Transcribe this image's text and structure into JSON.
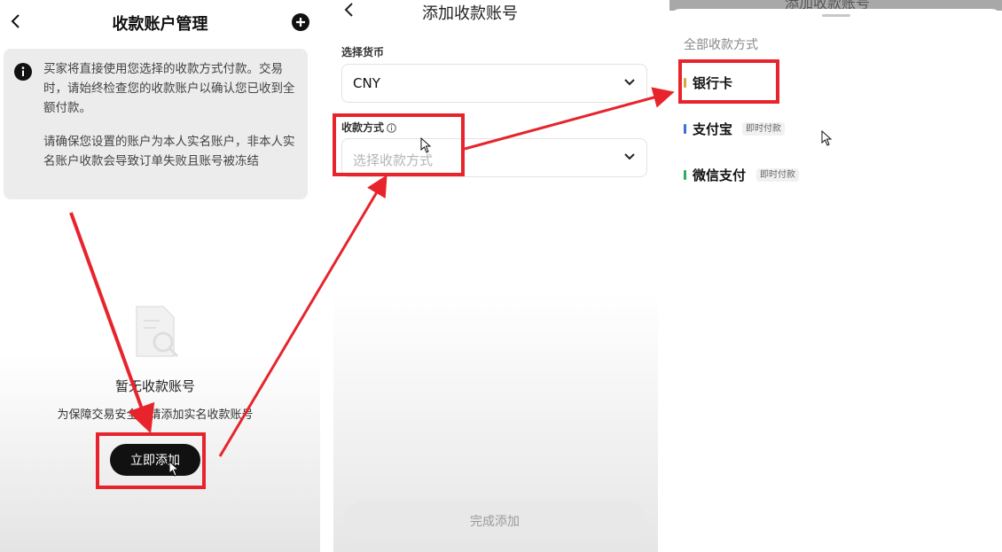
{
  "panel1": {
    "title": "收款账户管理",
    "notice_line1": "买家将直接使用您选择的收款方式付款。交易时，请始终检查您的收款账户以确认您已收到全额付款。",
    "notice_line2": "请确保您设置的账户为本人实名账户，非本人实名账户收款会导致订单失败且账号被冻结",
    "empty_title": "暂无收款账号",
    "empty_desc": "为保障交易安全，请添加实名收款账号",
    "add_button": "立即添加"
  },
  "panel2": {
    "title": "添加收款账号",
    "currency_label": "选择货币",
    "currency_value": "CNY",
    "method_label": "收款方式",
    "method_placeholder": "选择收款方式",
    "done_button": "完成添加"
  },
  "panel3": {
    "behind_title": "添加收款账号",
    "sheet_title": "全部收款方式",
    "options": [
      {
        "label": "银行卡",
        "badge": "",
        "color": "#d9a441"
      },
      {
        "label": "支付宝",
        "badge": "即时付款",
        "color": "#3b6fd6"
      },
      {
        "label": "微信支付",
        "badge": "即时付款",
        "color": "#2aae67"
      }
    ]
  },
  "colors": {
    "annotation": "#e7242c",
    "primary_button": "#111111"
  }
}
